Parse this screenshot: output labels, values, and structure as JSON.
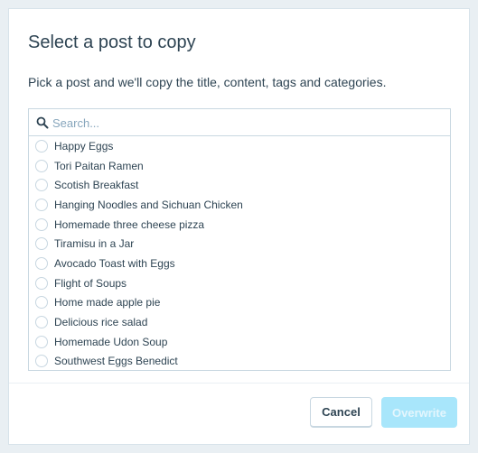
{
  "dialog": {
    "title": "Select a post to copy",
    "subtitle": "Pick a post and we'll copy the title, content, tags and categories."
  },
  "search": {
    "placeholder": "Search..."
  },
  "posts": [
    {
      "label": "Happy Eggs"
    },
    {
      "label": "Tori Paitan Ramen"
    },
    {
      "label": "Scotish Breakfast"
    },
    {
      "label": "Hanging Noodles and Sichuan Chicken"
    },
    {
      "label": "Homemade three cheese pizza"
    },
    {
      "label": "Tiramisu in a Jar"
    },
    {
      "label": "Avocado Toast with Eggs"
    },
    {
      "label": "Flight of Soups"
    },
    {
      "label": "Home made apple pie"
    },
    {
      "label": "Delicious rice salad"
    },
    {
      "label": "Homemade Udon Soup"
    },
    {
      "label": "Southwest Eggs Benedict"
    }
  ],
  "buttons": {
    "cancel": "Cancel",
    "overwrite": "Overwrite"
  },
  "colors": {
    "text": "#2e4453",
    "border": "#c8d7e1",
    "placeholder": "#87a6bc",
    "primary_disabled": "#a8e6fb"
  },
  "icons": {
    "search": "search-icon"
  }
}
